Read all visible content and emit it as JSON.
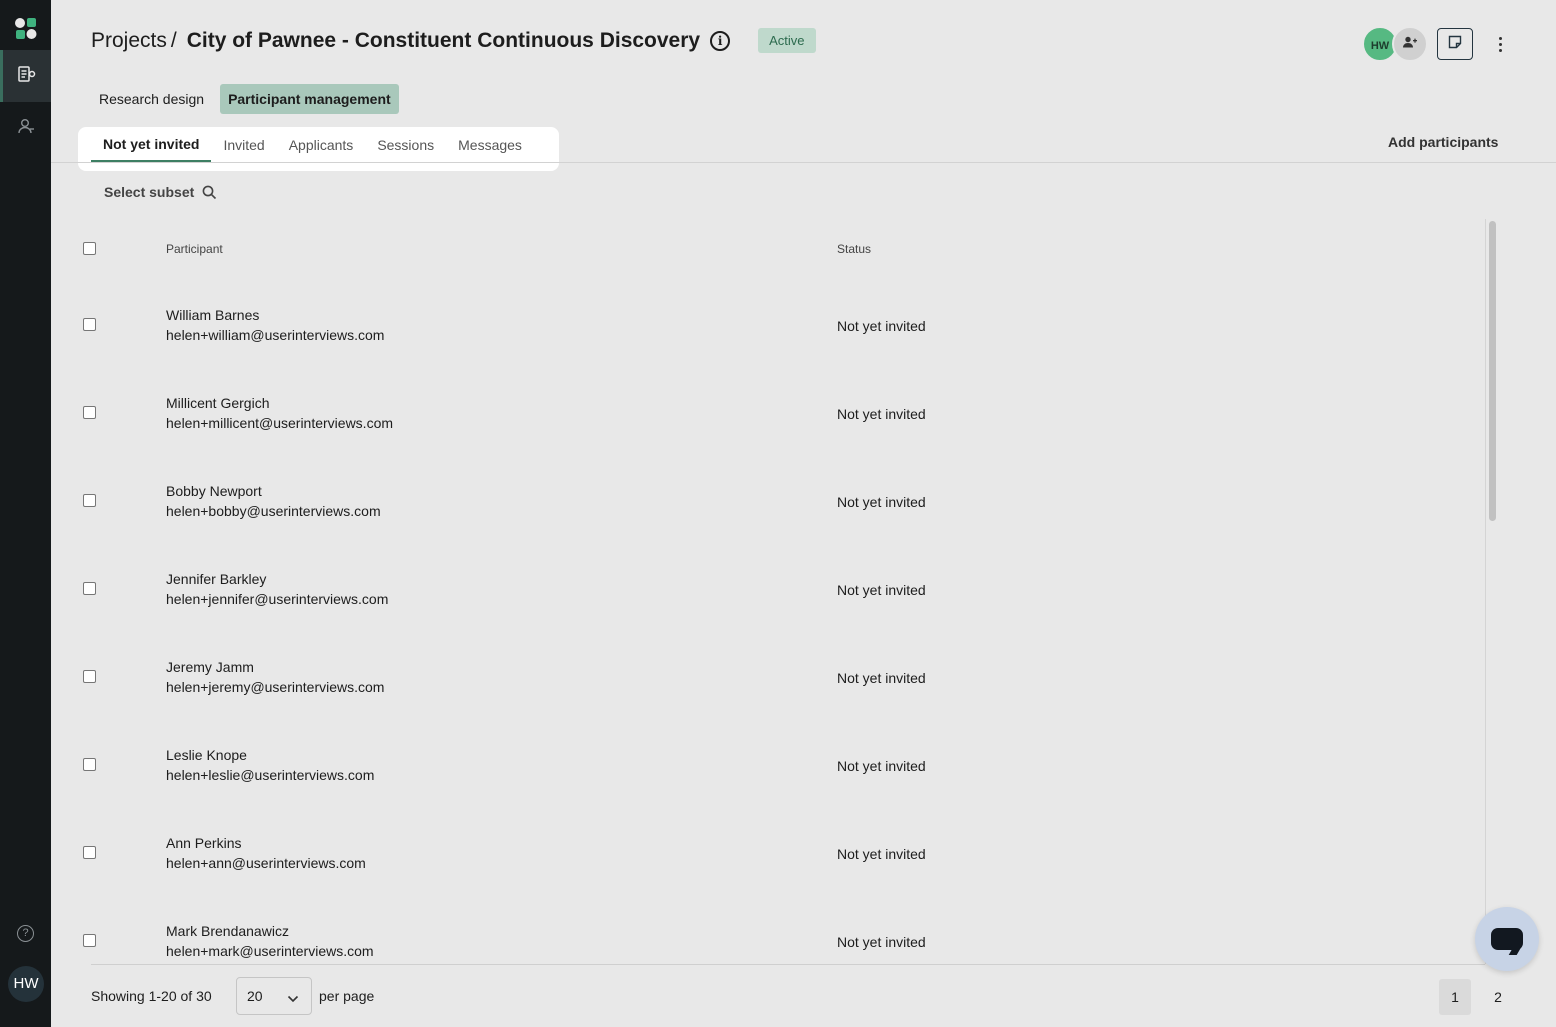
{
  "sidebar": {
    "items": [
      {
        "name": "projects",
        "icon": "projects-icon",
        "active": true
      },
      {
        "name": "participants",
        "icon": "participants-icon",
        "active": false
      }
    ],
    "help_icon": "help-icon",
    "avatar_initials": "HW"
  },
  "header": {
    "breadcrumb_root": "Projects",
    "breadcrumb_sep": "/",
    "project_title": "City of Pawnee - Constituent Continuous Discovery",
    "status_badge": "Active",
    "team_avatar_initials": "HW"
  },
  "main_tabs": [
    {
      "label": "Research design",
      "active": false
    },
    {
      "label": "Participant management",
      "active": true
    }
  ],
  "sub_tabs": [
    {
      "label": "Not yet invited",
      "active": true
    },
    {
      "label": "Invited",
      "active": false
    },
    {
      "label": "Applicants",
      "active": false
    },
    {
      "label": "Sessions",
      "active": false
    },
    {
      "label": "Messages",
      "active": false
    }
  ],
  "add_participants_label": "Add participants",
  "select_subset_label": "Select subset",
  "table": {
    "columns": [
      "Participant",
      "Status"
    ],
    "rows": [
      {
        "name": "William Barnes",
        "email": "helen+william@userinterviews.com",
        "status": "Not yet invited"
      },
      {
        "name": "Millicent Gergich",
        "email": "helen+millicent@userinterviews.com",
        "status": "Not yet invited"
      },
      {
        "name": "Bobby Newport",
        "email": "helen+bobby@userinterviews.com",
        "status": "Not yet invited"
      },
      {
        "name": "Jennifer Barkley",
        "email": "helen+jennifer@userinterviews.com",
        "status": "Not yet invited"
      },
      {
        "name": "Jeremy Jamm",
        "email": "helen+jeremy@userinterviews.com",
        "status": "Not yet invited"
      },
      {
        "name": "Leslie Knope",
        "email": "helen+leslie@userinterviews.com",
        "status": "Not yet invited"
      },
      {
        "name": "Ann Perkins",
        "email": "helen+ann@userinterviews.com",
        "status": "Not yet invited"
      },
      {
        "name": "Mark Brendanawicz",
        "email": "helen+mark@userinterviews.com",
        "status": "Not yet invited"
      }
    ]
  },
  "footer": {
    "showing": "Showing 1-20 of 30",
    "per_page_value": "20",
    "per_page_label": "per page",
    "pages": [
      "1",
      "2"
    ],
    "current_page": "1"
  },
  "colors": {
    "sidebar_bg": "#15191b",
    "accent_green": "#3d7f63",
    "active_tab_bg": "#a9c8bb",
    "badge_bg": "#bfd9cc",
    "page_bg": "#e8e8e8"
  }
}
